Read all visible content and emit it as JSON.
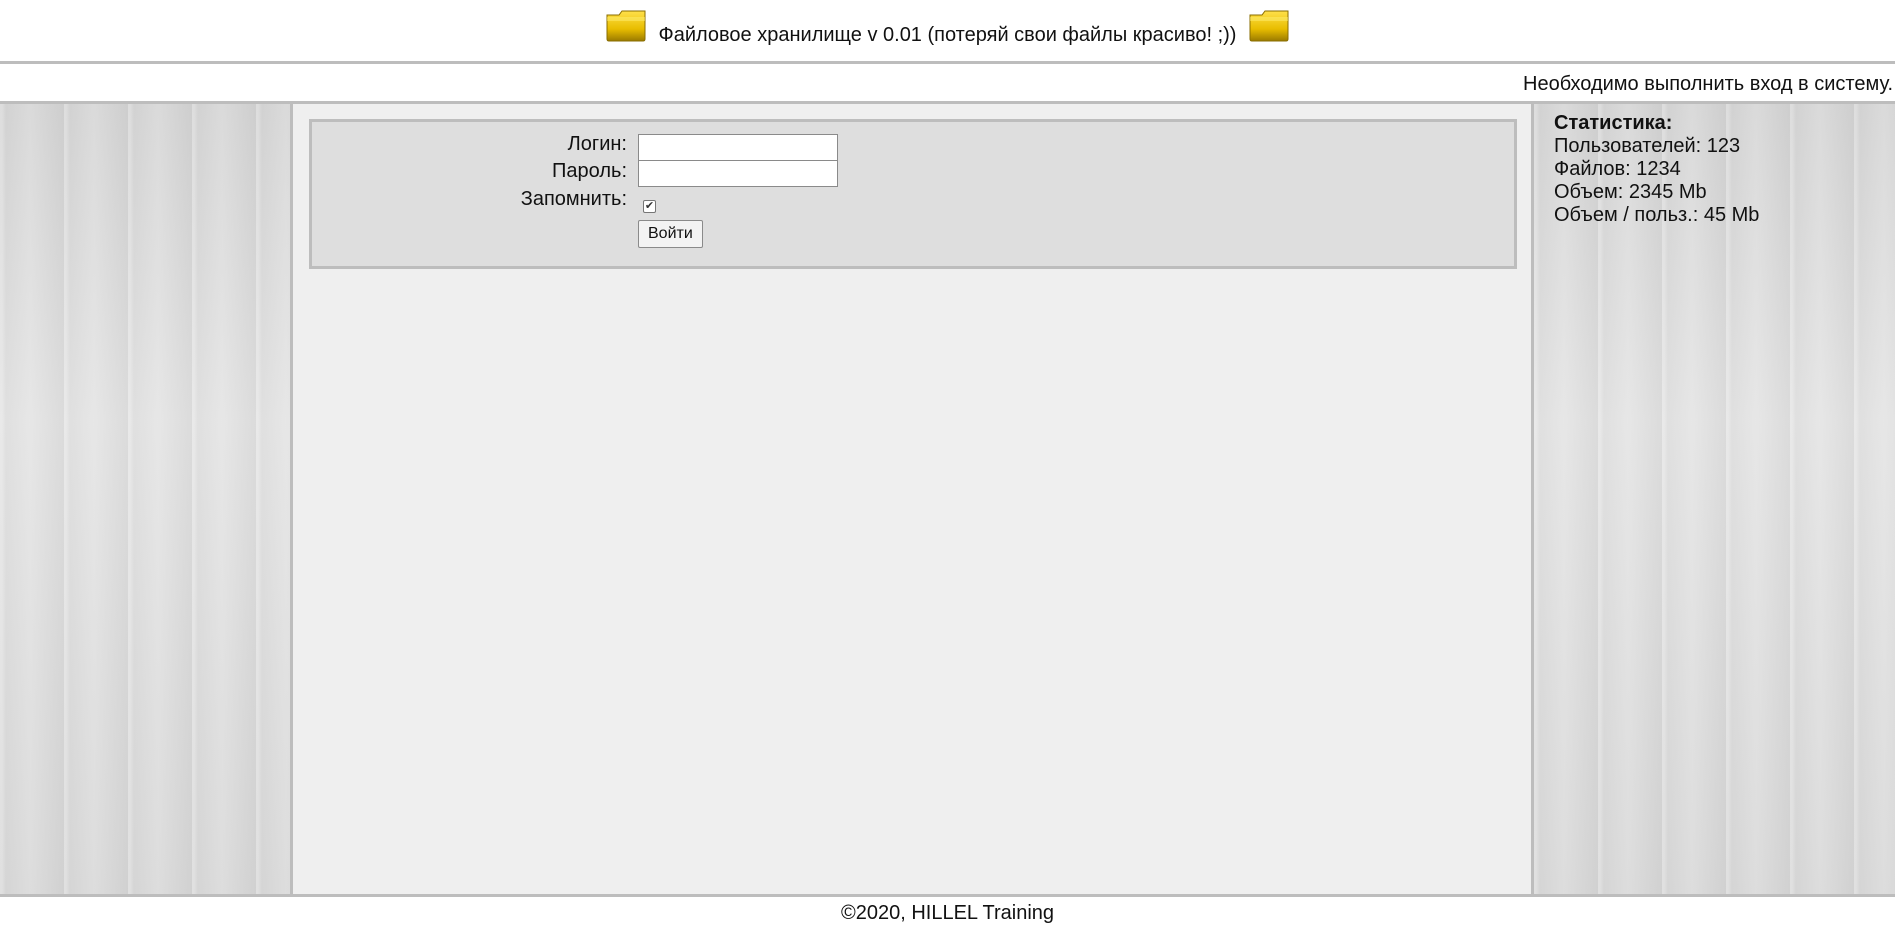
{
  "header": {
    "title": "Файловое хранилище v 0.01 (потеряй свои файлы красиво! ;))",
    "icon_left": "folder-icon",
    "icon_right": "folder-icon",
    "folder_color": "#e8bd00"
  },
  "status": {
    "message": "Необходимо выполнить вход в систему."
  },
  "login": {
    "login_label": "Логин:",
    "login_value": "",
    "password_label": "Пароль:",
    "password_value": "",
    "remember_label": "Запомнить:",
    "remember_checked": true,
    "submit_label": "Войти"
  },
  "stats": {
    "heading": "Статистика:",
    "users": "Пользователей: 123",
    "files": "Файлов: 1234",
    "volume": "Объем: 2345 Mb",
    "volume_per_user": "Объем / польз.: 45 Mb"
  },
  "footer": {
    "copyright": "©2020, HILLEL Training"
  }
}
